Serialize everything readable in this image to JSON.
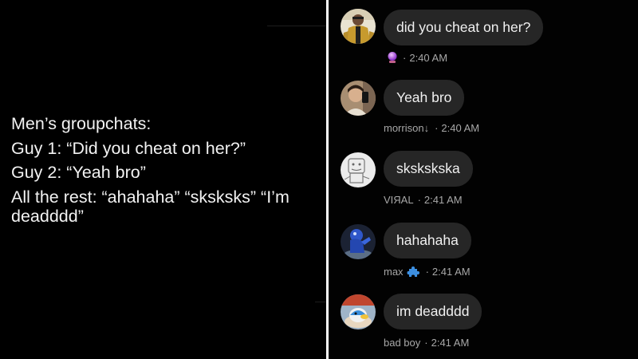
{
  "meme": {
    "lines": [
      "Men’s groupchats:",
      "Guy 1: “Did you cheat on her?”",
      "Guy 2: “Yeah bro”",
      "All the rest: “ahahaha” “sksksks” “I’m",
      "deadddd”"
    ]
  },
  "chat": {
    "messages": [
      {
        "text": "did you cheat on her?",
        "sender": "",
        "time": "2:40 AM",
        "sender_emoji": "crystal-ball-icon",
        "avatar": "avatar-gold-suit"
      },
      {
        "text": "Yeah bro",
        "sender": "morrison↓",
        "time": "2:40 AM",
        "avatar": "avatar-selfie"
      },
      {
        "text": "skskskska",
        "sender": "VIЯAL",
        "time": "2:41 AM",
        "avatar": "avatar-sketch"
      },
      {
        "text": "hahahaha",
        "sender": "max",
        "time": "2:41 AM",
        "sender_emoji": "puzzle-piece-icon",
        "avatar": "avatar-blue-figure"
      },
      {
        "text": "im deadddd",
        "sender": "bad boy",
        "time": "2:41 AM",
        "avatar": "avatar-toy-figure"
      }
    ],
    "separator": "·"
  }
}
